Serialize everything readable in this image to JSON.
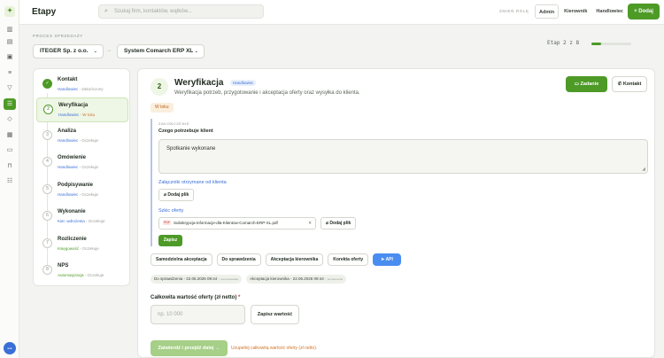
{
  "topbar": {
    "title": "Etapy",
    "search_placeholder": "Szukaj firm, kontaktów, wątków...",
    "role_label": "ZMIEŃ ROLĘ",
    "roles": [
      "Admin",
      "Kierownik",
      "Handlowiec"
    ],
    "selected_role": "Admin",
    "add_label": "Dodaj"
  },
  "process": {
    "label": "PROCES SPRZEDAŻY",
    "company": "ITEGER Sp. z o.o.",
    "system": "System Comarch ERP XL",
    "separator": "→",
    "stage_text": "Etap 2 z 8",
    "stage_progress": 0.25
  },
  "steps": [
    {
      "num": "✓",
      "title": "Kontakt",
      "owner": "Handlowiec",
      "status": "Zakończony",
      "state": "done"
    },
    {
      "num": "2",
      "title": "Weryfikacja",
      "owner": "Handlowiec",
      "status": "W toku",
      "state": "current"
    },
    {
      "num": "3",
      "title": "Analiza",
      "owner": "Handlowiec",
      "status": "Oczekuje",
      "state": "pending"
    },
    {
      "num": "4",
      "title": "Omówienie",
      "owner": "Handlowiec",
      "status": "Oczekuje",
      "state": "pending"
    },
    {
      "num": "5",
      "title": "Podpisywanie",
      "owner": "Handlowiec",
      "status": "Oczekuje",
      "state": "pending"
    },
    {
      "num": "6",
      "title": "Wykonanie",
      "owner": "Kier. wdrożenia",
      "status": "Oczekuje",
      "state": "pending"
    },
    {
      "num": "7",
      "title": "Rozliczenie",
      "owner": "Księgowość",
      "status": "Oczekuje",
      "state": "pending"
    },
    {
      "num": "8",
      "title": "NPS",
      "owner": "Automatyzacja",
      "status": "Oczekuje",
      "state": "pending"
    }
  ],
  "main": {
    "num": "2",
    "title": "Weryfikacja",
    "owner": "Handlowiec",
    "description": "Weryfikacja potrzeb, przygotowanie i akceptacja oferty oraz wysyłka do klienta.",
    "task_label": "Zadanie",
    "contact_label": "Kontakt",
    "status_badge": "W toku",
    "section_label": "ZAKOŃCZENIE",
    "question": "Czego potrzebuje klient",
    "answer": "Spotkanie wykonane",
    "attachments_label": "Załączniki otrzymane od klienta",
    "add_file_label": "Dodaj plik",
    "draft_label": "Szkic oferty",
    "file_type": "PDF",
    "file_name": "Subskrypcja-informacje-dla-Klientow-Comarch-ERP-XL.pdf",
    "save_label": "Zapisz",
    "actions": [
      "Samodzielna akceptacja",
      "Do sprawdzenia",
      "Akceptacja kierownika",
      "Korekta oferty",
      "API"
    ],
    "logs": [
      {
        "text": "Do sprawdzenia - 22.06.2026 09:44",
        "who": "anna.kowalska"
      },
      {
        "text": "Akceptacja kierownika - 22.06.2026 09:44",
        "who": "jan.kierownik"
      }
    ],
    "value_label": "Całkowita wartość oferty (zł netto)",
    "value_placeholder": "np. 10 000",
    "save_value_label": "Zapisz wartość",
    "approve_label": "Zatwierdź i przejdź dalej",
    "hint": "Uzupełnij całkowitą wartość oferty (zł netto)."
  },
  "colors": {
    "accent": "#4d9a27",
    "link": "#3a6fd8",
    "warning": "#d0762b"
  }
}
